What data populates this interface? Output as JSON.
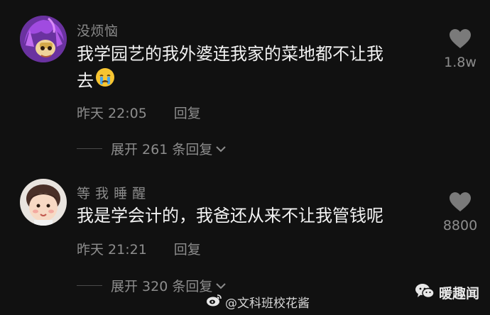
{
  "comments": [
    {
      "username": "没烦恼",
      "text_line1": "我学园艺的我外婆连我家的菜地都不让我",
      "text_line2": "去",
      "time": "昨天 22:05",
      "reply_label": "回复",
      "likes": "1.8w",
      "expand_label": "展开 261 条回复",
      "avatar_icon": "purple-hair-avatar"
    },
    {
      "username": "等 我 睡 醒",
      "text_line1": "我是学会计的，我爸还从来不让我管钱呢",
      "time": "昨天 21:21",
      "reply_label": "回复",
      "likes": "8800",
      "expand_label": "展开 320 条回复",
      "avatar_icon": "child-avatar"
    }
  ],
  "watermark": {
    "text": "@文科班校花酱",
    "icon": "weibo-icon"
  },
  "brand": {
    "text": "暖趣闻",
    "icon": "wechat-icon"
  },
  "colors": {
    "background": "#111111",
    "text": "#f2f2f2",
    "muted": "#8d8d8d"
  }
}
